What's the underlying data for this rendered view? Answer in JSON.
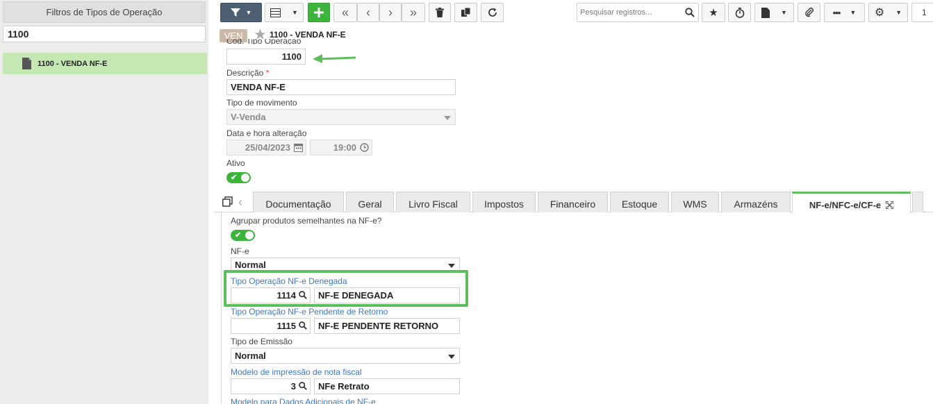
{
  "left_panel": {
    "title": "Filtros de Tipos de Operação",
    "search_value": "1100",
    "items": [
      {
        "label": "1100 - VENDA NF-E"
      }
    ]
  },
  "toolbar": {
    "search_placeholder": "Pesquisar registros...",
    "trailing_value": "1"
  },
  "record": {
    "badge": "VEN",
    "title": "1100 - VENDA NF-E"
  },
  "form": {
    "cod_label": "Cod. Tipo Operação",
    "cod_value": "1100",
    "descricao_label": "Descrição",
    "descricao_required": "*",
    "descricao_value": "VENDA NF-E",
    "tipo_mov_label": "Tipo de movimento",
    "tipo_mov_value": "V-Venda",
    "data_label": "Data e hora alteração",
    "data_value": "25/04/2023",
    "hora_value": "19:00",
    "ativo_label": "Ativo"
  },
  "tabs": [
    {
      "label": "Documentação"
    },
    {
      "label": "Geral"
    },
    {
      "label": "Livro Fiscal"
    },
    {
      "label": "Impostos"
    },
    {
      "label": "Financeiro"
    },
    {
      "label": "Estoque"
    },
    {
      "label": "WMS"
    },
    {
      "label": "Armazéns"
    },
    {
      "label": "NF-e/NFC-e/CF-e",
      "active": true
    }
  ],
  "nfe_tab": {
    "agrupar_label": "Agrupar produtos semelhantes na NF-e?",
    "nfe_label": "NF-e",
    "nfe_value": "Normal",
    "denegada_label": "Tipo Operação NF-e Denegada",
    "denegada_code": "1114",
    "denegada_desc": "NF-E DENEGADA",
    "pendente_label": "Tipo Operação NF-e Pendente de Retorno",
    "pendente_code": "1115",
    "pendente_desc": "NF-E PENDENTE RETORNO",
    "emissao_label": "Tipo de Emissão",
    "emissao_value": "Normal",
    "modelo_label": "Modelo de impressão de nota fiscal",
    "modelo_code": "3",
    "modelo_desc": "NFe Retrato",
    "modelo_dados_label": "Modelo para Dados Adicionais de NF-e"
  },
  "colors": {
    "accent_green": "#3db53d",
    "highlight_green": "#5cbf5c",
    "toolbar_dark": "#4c5f73",
    "link_blue": "#3a78c7"
  }
}
